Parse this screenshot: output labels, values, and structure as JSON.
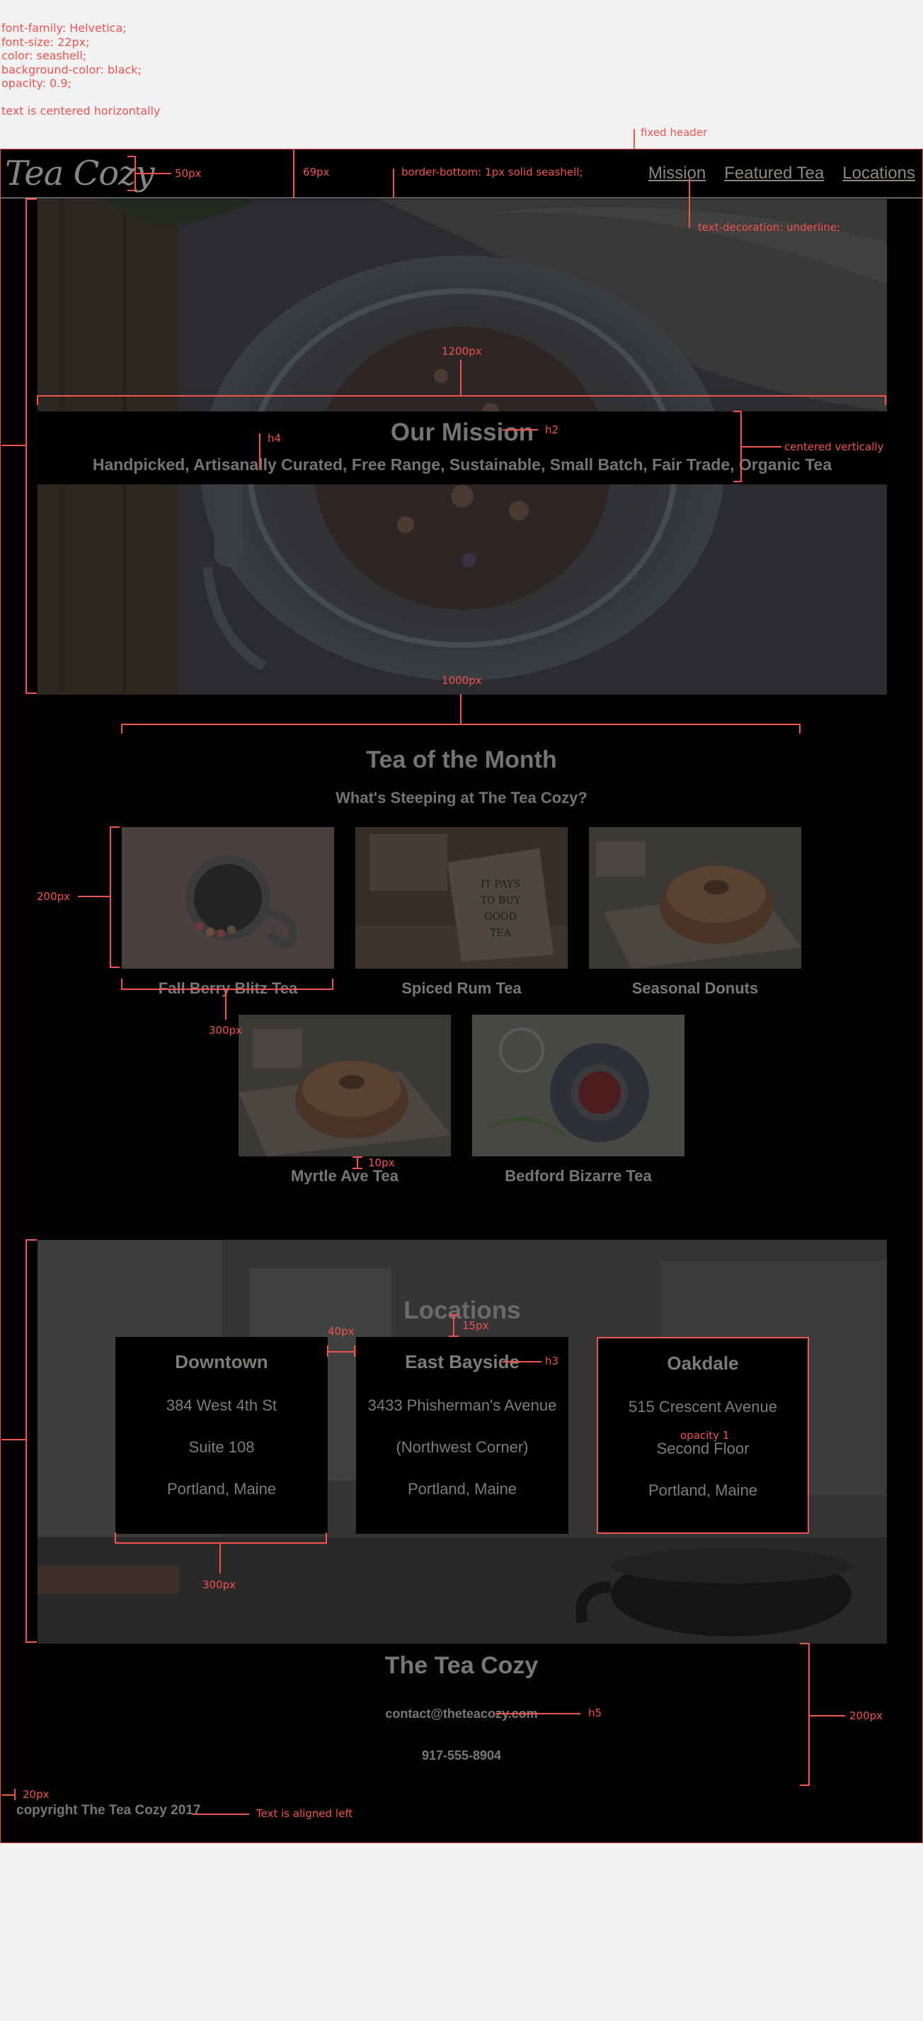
{
  "annotations": {
    "specs": [
      "font-family: Helvetica;",
      "font-size: 22px;",
      "color: seashell;",
      "background-color: black;",
      "opacity: 0.9;",
      "",
      "text is centered horizontally"
    ],
    "fixed_header": "fixed header",
    "px50": "50px",
    "px69": "69px",
    "border_bottom": "border-bottom: 1px solid seashell;",
    "text_decoration": "text-decoration: underline;",
    "px1200": "1200px",
    "h2": "h2",
    "h4": "h4",
    "centered_vertically": "centered vertically",
    "px1000": "1000px",
    "px200": "200px",
    "px300": "300px",
    "px10": "10px",
    "px40": "40px",
    "px15": "15px",
    "h3": "h3",
    "opacity1": "opacity 1",
    "px300b": "300px",
    "h5": "h5",
    "px200b": "200px",
    "px20": "20px",
    "text_left": "Text is aligned left"
  },
  "header": {
    "logo": "Tea Cozy",
    "nav": [
      "Mission",
      "Featured Tea",
      "Locations"
    ]
  },
  "mission": {
    "title": "Our Mission",
    "subtitle": "Handpicked, Artisanally Curated, Free Range, Sustainable, Small Batch, Fair Trade, Organic Tea"
  },
  "tea": {
    "title": "Tea of the Month",
    "subtitle": "What's Steeping at The Tea Cozy?",
    "items": [
      "Fall Berry Blitz Tea",
      "Spiced Rum Tea",
      "Seasonal Donuts",
      "Myrtle Ave Tea",
      "Bedford Bizarre Tea"
    ],
    "sign_text": [
      "IT PAYS",
      "TO BUY",
      "GOOD",
      "TEA"
    ]
  },
  "locations": {
    "title": "Locations",
    "cards": [
      {
        "name": "Downtown",
        "l1": "384 West 4th St",
        "l2": "Suite 108",
        "l3": "Portland, Maine"
      },
      {
        "name": "East Bayside",
        "l1": "3433 Phisherman's Avenue",
        "l2": "(Northwest Corner)",
        "l3": "Portland, Maine"
      },
      {
        "name": "Oakdale",
        "l1": "515 Crescent Avenue",
        "l2": "Second Floor",
        "l3": "Portland, Maine"
      }
    ]
  },
  "footer": {
    "title": "The Tea Cozy",
    "email": "contact@theteacozy.com",
    "phone": "917-555-8904",
    "copyright": "copyright The Tea Cozy 2017"
  },
  "colors": {
    "accent": "#ef5350",
    "background": "#030303",
    "text": "#7a7673"
  }
}
